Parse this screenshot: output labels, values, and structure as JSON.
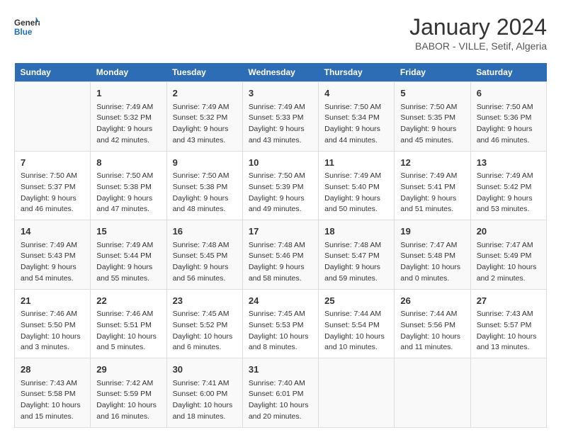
{
  "header": {
    "logo_general": "General",
    "logo_blue": "Blue",
    "title": "January 2024",
    "subtitle": "BABOR - VILLE, Setif, Algeria"
  },
  "columns": [
    "Sunday",
    "Monday",
    "Tuesday",
    "Wednesday",
    "Thursday",
    "Friday",
    "Saturday"
  ],
  "weeks": [
    {
      "days": [
        {
          "num": "",
          "info": ""
        },
        {
          "num": "1",
          "info": "Sunrise: 7:49 AM\nSunset: 5:32 PM\nDaylight: 9 hours\nand 42 minutes."
        },
        {
          "num": "2",
          "info": "Sunrise: 7:49 AM\nSunset: 5:32 PM\nDaylight: 9 hours\nand 43 minutes."
        },
        {
          "num": "3",
          "info": "Sunrise: 7:49 AM\nSunset: 5:33 PM\nDaylight: 9 hours\nand 43 minutes."
        },
        {
          "num": "4",
          "info": "Sunrise: 7:50 AM\nSunset: 5:34 PM\nDaylight: 9 hours\nand 44 minutes."
        },
        {
          "num": "5",
          "info": "Sunrise: 7:50 AM\nSunset: 5:35 PM\nDaylight: 9 hours\nand 45 minutes."
        },
        {
          "num": "6",
          "info": "Sunrise: 7:50 AM\nSunset: 5:36 PM\nDaylight: 9 hours\nand 46 minutes."
        }
      ]
    },
    {
      "days": [
        {
          "num": "7",
          "info": "Sunrise: 7:50 AM\nSunset: 5:37 PM\nDaylight: 9 hours\nand 46 minutes."
        },
        {
          "num": "8",
          "info": "Sunrise: 7:50 AM\nSunset: 5:38 PM\nDaylight: 9 hours\nand 47 minutes."
        },
        {
          "num": "9",
          "info": "Sunrise: 7:50 AM\nSunset: 5:38 PM\nDaylight: 9 hours\nand 48 minutes."
        },
        {
          "num": "10",
          "info": "Sunrise: 7:50 AM\nSunset: 5:39 PM\nDaylight: 9 hours\nand 49 minutes."
        },
        {
          "num": "11",
          "info": "Sunrise: 7:49 AM\nSunset: 5:40 PM\nDaylight: 9 hours\nand 50 minutes."
        },
        {
          "num": "12",
          "info": "Sunrise: 7:49 AM\nSunset: 5:41 PM\nDaylight: 9 hours\nand 51 minutes."
        },
        {
          "num": "13",
          "info": "Sunrise: 7:49 AM\nSunset: 5:42 PM\nDaylight: 9 hours\nand 53 minutes."
        }
      ]
    },
    {
      "days": [
        {
          "num": "14",
          "info": "Sunrise: 7:49 AM\nSunset: 5:43 PM\nDaylight: 9 hours\nand 54 minutes."
        },
        {
          "num": "15",
          "info": "Sunrise: 7:49 AM\nSunset: 5:44 PM\nDaylight: 9 hours\nand 55 minutes."
        },
        {
          "num": "16",
          "info": "Sunrise: 7:48 AM\nSunset: 5:45 PM\nDaylight: 9 hours\nand 56 minutes."
        },
        {
          "num": "17",
          "info": "Sunrise: 7:48 AM\nSunset: 5:46 PM\nDaylight: 9 hours\nand 58 minutes."
        },
        {
          "num": "18",
          "info": "Sunrise: 7:48 AM\nSunset: 5:47 PM\nDaylight: 9 hours\nand 59 minutes."
        },
        {
          "num": "19",
          "info": "Sunrise: 7:47 AM\nSunset: 5:48 PM\nDaylight: 10 hours\nand 0 minutes."
        },
        {
          "num": "20",
          "info": "Sunrise: 7:47 AM\nSunset: 5:49 PM\nDaylight: 10 hours\nand 2 minutes."
        }
      ]
    },
    {
      "days": [
        {
          "num": "21",
          "info": "Sunrise: 7:46 AM\nSunset: 5:50 PM\nDaylight: 10 hours\nand 3 minutes."
        },
        {
          "num": "22",
          "info": "Sunrise: 7:46 AM\nSunset: 5:51 PM\nDaylight: 10 hours\nand 5 minutes."
        },
        {
          "num": "23",
          "info": "Sunrise: 7:45 AM\nSunset: 5:52 PM\nDaylight: 10 hours\nand 6 minutes."
        },
        {
          "num": "24",
          "info": "Sunrise: 7:45 AM\nSunset: 5:53 PM\nDaylight: 10 hours\nand 8 minutes."
        },
        {
          "num": "25",
          "info": "Sunrise: 7:44 AM\nSunset: 5:54 PM\nDaylight: 10 hours\nand 10 minutes."
        },
        {
          "num": "26",
          "info": "Sunrise: 7:44 AM\nSunset: 5:56 PM\nDaylight: 10 hours\nand 11 minutes."
        },
        {
          "num": "27",
          "info": "Sunrise: 7:43 AM\nSunset: 5:57 PM\nDaylight: 10 hours\nand 13 minutes."
        }
      ]
    },
    {
      "days": [
        {
          "num": "28",
          "info": "Sunrise: 7:43 AM\nSunset: 5:58 PM\nDaylight: 10 hours\nand 15 minutes."
        },
        {
          "num": "29",
          "info": "Sunrise: 7:42 AM\nSunset: 5:59 PM\nDaylight: 10 hours\nand 16 minutes."
        },
        {
          "num": "30",
          "info": "Sunrise: 7:41 AM\nSunset: 6:00 PM\nDaylight: 10 hours\nand 18 minutes."
        },
        {
          "num": "31",
          "info": "Sunrise: 7:40 AM\nSunset: 6:01 PM\nDaylight: 10 hours\nand 20 minutes."
        },
        {
          "num": "",
          "info": ""
        },
        {
          "num": "",
          "info": ""
        },
        {
          "num": "",
          "info": ""
        }
      ]
    }
  ]
}
